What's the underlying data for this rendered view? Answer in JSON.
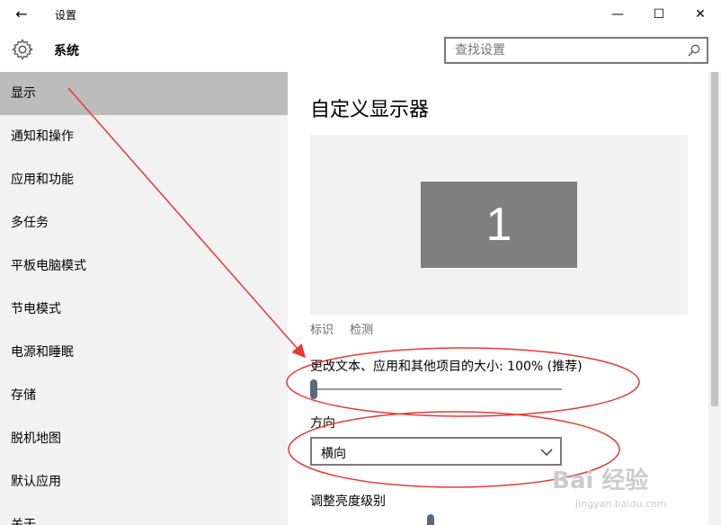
{
  "window": {
    "title": "设置",
    "back_icon": "←",
    "minimize_icon": "—",
    "maximize_icon": "☐",
    "close_icon": "✕"
  },
  "header": {
    "section_title": "系统",
    "search_placeholder": "查找设置"
  },
  "sidebar": {
    "items": [
      {
        "label": "显示",
        "active": true
      },
      {
        "label": "通知和操作"
      },
      {
        "label": "应用和功能"
      },
      {
        "label": "多任务"
      },
      {
        "label": "平板电脑模式"
      },
      {
        "label": "节电模式"
      },
      {
        "label": "电源和睡眠"
      },
      {
        "label": "存储"
      },
      {
        "label": "脱机地图"
      },
      {
        "label": "默认应用"
      },
      {
        "label": "关于"
      }
    ]
  },
  "main": {
    "title": "自定义显示器",
    "monitor_number": "1",
    "identify_link": "标识",
    "detect_link": "检测",
    "scale_label": "更改文本、应用和其他项目的大小: 100% (推荐)",
    "scale_level": 0,
    "orientation_label": "方向",
    "orientation_value": "横向",
    "brightness_label": "调整亮度级别"
  },
  "watermark": {
    "text": "Bai 经验",
    "sub": "jingyan.baidu.com"
  },
  "colors": {
    "sidebar_bg": "#f2f2f2",
    "active_item_bg": "#bcbcbc",
    "monitor_bg": "#7f7f7f",
    "annotation_red": "#e53935"
  }
}
